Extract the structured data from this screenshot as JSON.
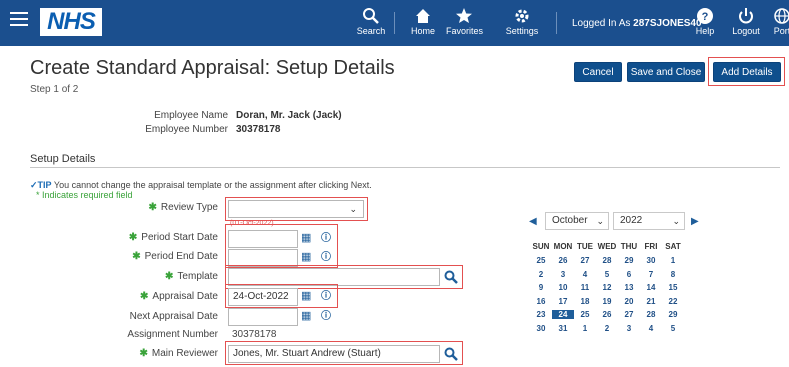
{
  "header": {
    "logo": "NHS",
    "nav": [
      {
        "label": "Search",
        "icon": "search-icon"
      },
      {
        "label": "Home",
        "icon": "home-icon"
      },
      {
        "label": "Favorites",
        "icon": "star-icon"
      },
      {
        "label": "Settings",
        "icon": "gear-icon"
      }
    ],
    "logged_in_prefix": "Logged In As ",
    "logged_in_user": "287SJONES40",
    "right_nav": [
      {
        "label": "Help",
        "icon": "help-icon"
      },
      {
        "label": "Logout",
        "icon": "power-icon"
      },
      {
        "label": "Port",
        "icon": "globe-icon"
      }
    ],
    "colors": {
      "bar": "#1b4f8e",
      "accent": "#0f4f8d",
      "highlight": "#e35050"
    }
  },
  "page": {
    "title": "Create Standard Appraisal: Setup Details",
    "step": "Step 1 of 2"
  },
  "actions": {
    "cancel": "Cancel",
    "save_close": "Save and Close",
    "add_details": "Add Details"
  },
  "employee": {
    "name_label": "Employee Name",
    "name_value": "Doran, Mr. Jack (Jack)",
    "number_label": "Employee Number",
    "number_value": "30378178"
  },
  "setup": {
    "heading": "Setup Details",
    "tip_prefix": "TIP",
    "tip_text": " You cannot change the appraisal template or the assignment after clicking Next.",
    "required_note": "* Indicates required field",
    "review_type_label": "Review Type",
    "review_type_value": "",
    "date_hint": "(01-Oct-2022)",
    "period_start_label": "Period Start Date",
    "period_start_value": "",
    "period_end_label": "Period End Date",
    "period_end_value": "",
    "template_label": "Template",
    "template_value": "",
    "appraisal_date_label": "Appraisal Date",
    "appraisal_date_value": "24-Oct-2022",
    "next_appraisal_label": "Next Appraisal Date",
    "next_appraisal_value": "",
    "assignment_label": "Assignment Number",
    "assignment_value": "30378178",
    "main_reviewer_label": "Main Reviewer",
    "main_reviewer_value": "Jones, Mr. Stuart Andrew (Stuart)"
  },
  "calendar": {
    "month": "October",
    "year": "2022",
    "days": [
      "SUN",
      "MON",
      "TUE",
      "WED",
      "THU",
      "FRI",
      "SAT"
    ],
    "weeks": [
      [
        "25",
        "26",
        "27",
        "28",
        "29",
        "30",
        "1"
      ],
      [
        "2",
        "3",
        "4",
        "5",
        "6",
        "7",
        "8"
      ],
      [
        "9",
        "10",
        "11",
        "12",
        "13",
        "14",
        "15"
      ],
      [
        "16",
        "17",
        "18",
        "19",
        "20",
        "21",
        "22"
      ],
      [
        "23",
        "24",
        "25",
        "26",
        "27",
        "28",
        "29"
      ],
      [
        "30",
        "31",
        "1",
        "2",
        "3",
        "4",
        "5"
      ]
    ],
    "selected": "24"
  }
}
